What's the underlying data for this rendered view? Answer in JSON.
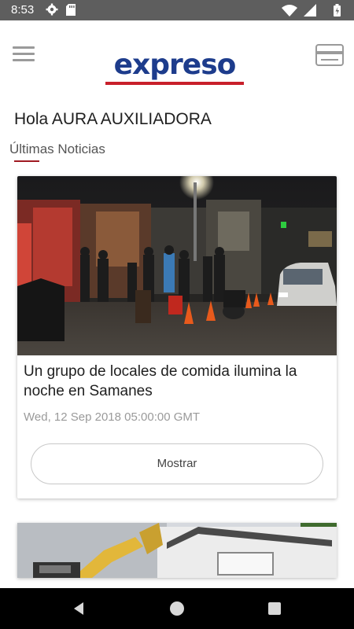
{
  "status_bar": {
    "time": "8:53",
    "icons": [
      "gear-icon",
      "sd-card-icon",
      "wifi-icon",
      "signal-icon",
      "battery-icon"
    ]
  },
  "header": {
    "logo_text": "expreso",
    "icons": [
      "menu-icon",
      "credit-card-icon"
    ],
    "brand_colors": {
      "logo_blue": "#1d3c8c",
      "logo_red": "#c8202a"
    }
  },
  "greeting": "Hola AURA AUXILIADORA",
  "section": {
    "title": "Últimas Noticias",
    "accent": "#a01a22"
  },
  "news": [
    {
      "title": "Un grupo de locales de comida ilumina la noche en Samanes",
      "date": "Wed, 12 Sep 2018 05:00:00 GMT",
      "button_label": "Mostrar"
    }
  ],
  "nav_bar": {
    "icons": [
      "back-icon",
      "home-icon",
      "recents-icon"
    ]
  }
}
